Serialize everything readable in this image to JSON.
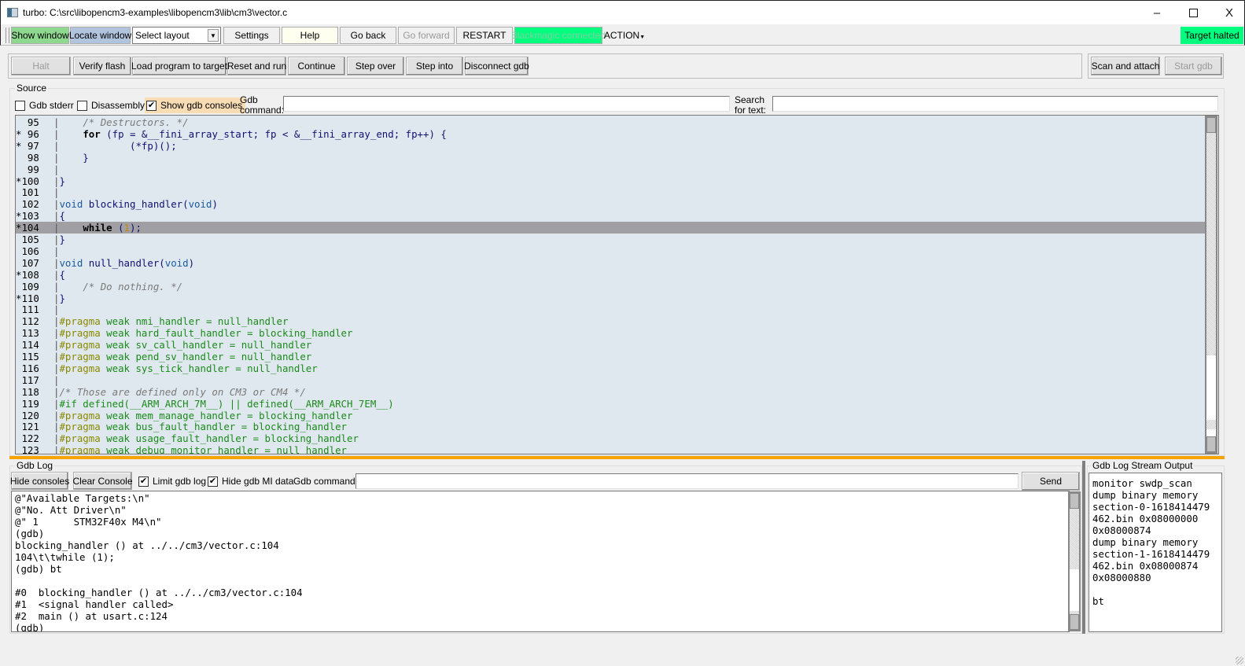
{
  "window": {
    "title": "turbo: C:\\src\\libopencm3-examples\\libopencm3\\lib\\cm3\\vector.c",
    "minimize": "–",
    "close": "X"
  },
  "toolbar": {
    "show_window": "Show window",
    "locate_window": "Locate window",
    "layout_select": "Select layout",
    "settings": "Settings",
    "help": "Help",
    "go_back": "Go back",
    "go_forward": "Go forward",
    "restart": "RESTART",
    "blackmagic": "Blackmagic connected",
    "action": "ACTION",
    "target_status": "Target halted",
    "colors": {
      "show_window_bg": "#8fd88f",
      "locate_window_bg": "#b0c4de",
      "help_bg": "#fffff0",
      "blackmagic_bg": "#00ff7f",
      "target_status_bg": "#00ff7f"
    }
  },
  "controls": {
    "halt": "Halt",
    "verify_flash": "Verify flash",
    "load_program": "Load program to target",
    "reset_and_run": "Reset and run",
    "continue": "Continue",
    "step_over": "Step over",
    "step_into": "Step into",
    "disconnect_gdb": "Disconnect gdb",
    "scan_and_attach": "Scan and attach",
    "start_gdb": "Start gdb"
  },
  "source": {
    "legend": "Source",
    "gdb_stderr": "Gdb stderr",
    "gdb_stderr_checked": false,
    "disassembly": "Disassembly",
    "disassembly_checked": false,
    "show_gdb_consoles": "Show gdb consoles",
    "show_gdb_consoles_checked": true,
    "gdb_command_label_1": "Gdb",
    "gdb_command_label_2": "command:",
    "gdb_command_value": "",
    "search_label_1": "Search",
    "search_label_2": "for text:",
    "search_value": "",
    "current_line": 104,
    "lines": [
      {
        "n": " 95 ",
        "code": [
          [
            "",
            "    "
          ],
          [
            "cm",
            "/* Destructors. */"
          ]
        ]
      },
      {
        "n": "* 96 ",
        "code": [
          [
            "",
            "    "
          ],
          [
            "kw",
            "for"
          ],
          [
            "id",
            " (fp = &__fini_array_start; fp < &__fini_array_end; fp++) {"
          ]
        ]
      },
      {
        "n": "* 97 ",
        "code": [
          [
            "id",
            "            (*fp)();"
          ]
        ]
      },
      {
        "n": " 98 ",
        "code": [
          [
            "id",
            "    }"
          ]
        ]
      },
      {
        "n": " 99 ",
        "code": []
      },
      {
        "n": "*100 ",
        "code": [
          [
            "id",
            "}"
          ]
        ]
      },
      {
        "n": " 101 ",
        "code": []
      },
      {
        "n": " 102 ",
        "code": [
          [
            "type",
            "void"
          ],
          [
            "id",
            " blocking_handler("
          ],
          [
            "type",
            "void"
          ],
          [
            "id",
            ")"
          ]
        ]
      },
      {
        "n": "*103 ",
        "code": [
          [
            "id",
            "{"
          ]
        ]
      },
      {
        "n": "*104 ",
        "code": [
          [
            "",
            "    "
          ],
          [
            "kw",
            "while"
          ],
          [
            "id",
            " ("
          ],
          [
            "num",
            "1"
          ],
          [
            "id",
            ");"
          ]
        ]
      },
      {
        "n": " 105 ",
        "code": [
          [
            "id",
            "}"
          ]
        ]
      },
      {
        "n": " 106 ",
        "code": []
      },
      {
        "n": " 107 ",
        "code": [
          [
            "type",
            "void"
          ],
          [
            "id",
            " null_handler("
          ],
          [
            "type",
            "void"
          ],
          [
            "id",
            ")"
          ]
        ]
      },
      {
        "n": "*108 ",
        "code": [
          [
            "id",
            "{"
          ]
        ]
      },
      {
        "n": " 109 ",
        "code": [
          [
            "",
            "    "
          ],
          [
            "cm",
            "/* Do nothing. */"
          ]
        ]
      },
      {
        "n": "*110 ",
        "code": [
          [
            "id",
            "}"
          ]
        ]
      },
      {
        "n": " 111 ",
        "code": []
      },
      {
        "n": " 112 ",
        "code": [
          [
            "pp",
            "#pragma"
          ],
          [
            "ppt",
            " weak nmi_handler = null_handler"
          ]
        ]
      },
      {
        "n": " 113 ",
        "code": [
          [
            "pp",
            "#pragma"
          ],
          [
            "ppt",
            " weak hard_fault_handler = blocking_handler"
          ]
        ]
      },
      {
        "n": " 114 ",
        "code": [
          [
            "pp",
            "#pragma"
          ],
          [
            "ppt",
            " weak sv_call_handler = null_handler"
          ]
        ]
      },
      {
        "n": " 115 ",
        "code": [
          [
            "pp",
            "#pragma"
          ],
          [
            "ppt",
            " weak pend_sv_handler = null_handler"
          ]
        ]
      },
      {
        "n": " 116 ",
        "code": [
          [
            "pp",
            "#pragma"
          ],
          [
            "ppt",
            " weak sys_tick_handler = null_handler"
          ]
        ]
      },
      {
        "n": " 117 ",
        "code": []
      },
      {
        "n": " 118 ",
        "code": [
          [
            "cm",
            "/* Those are defined only on CM3 or CM4 */"
          ]
        ]
      },
      {
        "n": " 119 ",
        "code": [
          [
            "ppt",
            "#if defined(__ARM_ARCH_7M__) || defined(__ARM_ARCH_7EM__)"
          ]
        ]
      },
      {
        "n": " 120 ",
        "code": [
          [
            "pp",
            "#pragma"
          ],
          [
            "ppt",
            " weak mem_manage_handler = blocking_handler"
          ]
        ]
      },
      {
        "n": " 121 ",
        "code": [
          [
            "pp",
            "#pragma"
          ],
          [
            "ppt",
            " weak bus_fault_handler = blocking_handler"
          ]
        ]
      },
      {
        "n": " 122 ",
        "code": [
          [
            "pp",
            "#pragma"
          ],
          [
            "ppt",
            " weak usage_fault_handler = blocking_handler"
          ]
        ]
      },
      {
        "n": " 123 ",
        "code": [
          [
            "pp",
            "#pragma"
          ],
          [
            "ppt",
            " weak debug_monitor_handler = null_handler"
          ]
        ]
      }
    ]
  },
  "gdb_log": {
    "legend": "Gdb Log",
    "hide_consoles": "Hide consoles",
    "clear_console": "Clear Console",
    "limit_gdb_log": "Limit gdb log",
    "limit_gdb_log_checked": true,
    "hide_gdb_mi_data": "Hide gdb MI data",
    "hide_gdb_mi_data_checked": true,
    "gdb_command_label": "Gdb command:",
    "gdb_command_value": "",
    "send": "Send",
    "lines": [
      "@\"Available Targets:\\n\"",
      "@\"No. Att Driver\\n\"",
      "@\" 1      STM32F40x M4\\n\"",
      "(gdb)",
      "blocking_handler () at ../../cm3/vector.c:104",
      "104\\t\\twhile (1);",
      "(gdb) bt",
      "",
      "#0  blocking_handler () at ../../cm3/vector.c:104",
      "#1  <signal handler called>",
      "#2  main () at usart.c:124",
      "(gdb)"
    ]
  },
  "stream_output": {
    "legend": "Gdb Log Stream Output",
    "lines": [
      "monitor swdp_scan",
      "dump binary memory",
      "section-0-1618414479",
      "462.bin 0x08000000",
      "0x08000874",
      "dump binary memory",
      "section-1-1618414479",
      "462.bin 0x08000874",
      "0x08000880",
      "",
      "bt"
    ]
  }
}
